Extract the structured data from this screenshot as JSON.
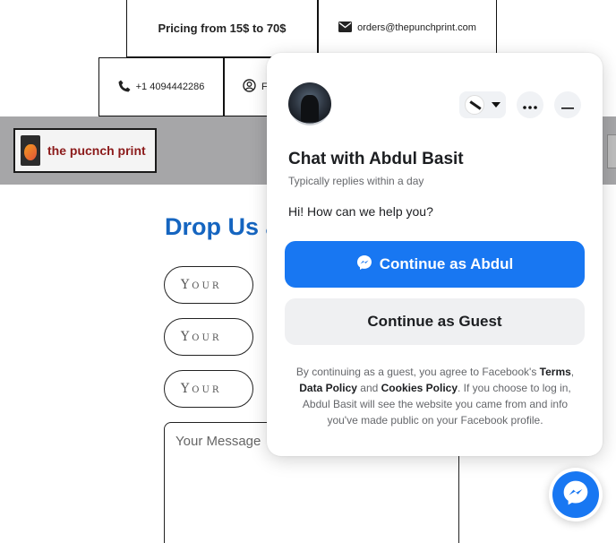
{
  "top_bar": {
    "pricing": "Pricing from 15$ to 70$",
    "email": "orders@thepunchprint.com",
    "phone": "+1 4094442286",
    "facebook_partial": "F"
  },
  "header": {
    "logo_text": "the pucnch print"
  },
  "form": {
    "title": "Drop Us a",
    "name_placeholder": "Your",
    "email_placeholder": "Your",
    "phone_placeholder": "Your",
    "message_placeholder": "Your Message"
  },
  "chat": {
    "title": "Chat with Abdul Basit",
    "subtitle": "Typically replies within a day",
    "greeting": "Hi! How can we help you?",
    "primary_label": "Continue as Abdul",
    "secondary_label": "Continue as Guest",
    "disclaimer": {
      "p1": "By continuing as a guest, you agree to Facebook's ",
      "terms": "Terms",
      "sep1": ", ",
      "data_policy": "Data Policy",
      "sep2": " and ",
      "cookies_policy": "Cookies Policy",
      "p2": ". If you choose to log in, Abdul Basit will see the website you came from and info you've made public on your Facebook profile."
    }
  },
  "colors": {
    "accent": "#1877f2",
    "form_title": "#1565c0",
    "header_band": "#a6a6a8"
  },
  "icons": {
    "email": "envelope-icon",
    "phone": "phone-icon",
    "facebook": "user-circle-icon",
    "more": "more-dots-icon",
    "minimize": "minimize-icon",
    "messenger": "messenger-icon"
  }
}
